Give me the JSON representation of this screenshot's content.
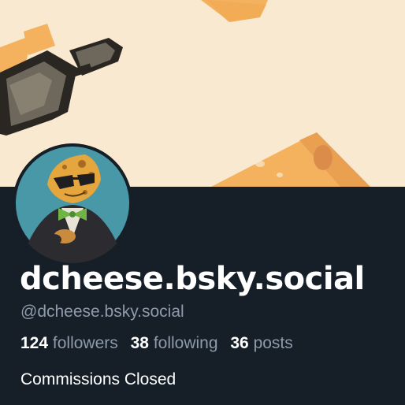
{
  "profile": {
    "display_name": "dcheese.bsky.social",
    "handle": "@dcheese.bsky.social",
    "stats": {
      "followers": {
        "count": "124",
        "label": "followers"
      },
      "following": {
        "count": "38",
        "label": "following"
      },
      "posts": {
        "count": "36",
        "label": "posts"
      }
    },
    "bio": "Commissions Closed"
  },
  "banner": {
    "icons": [
      "sunglasses-icon",
      "cheese-wedge-icon"
    ]
  },
  "avatar": {
    "icon": "cheese-character-tuxedo-icon"
  },
  "colors": {
    "banner_background": "#f8e9d0",
    "cheese": "#f4b25f",
    "cheese_hole": "#dc8c4a",
    "panel_background": "#161e27",
    "text_primary": "#ffffff",
    "text_secondary": "#8d9bac"
  }
}
